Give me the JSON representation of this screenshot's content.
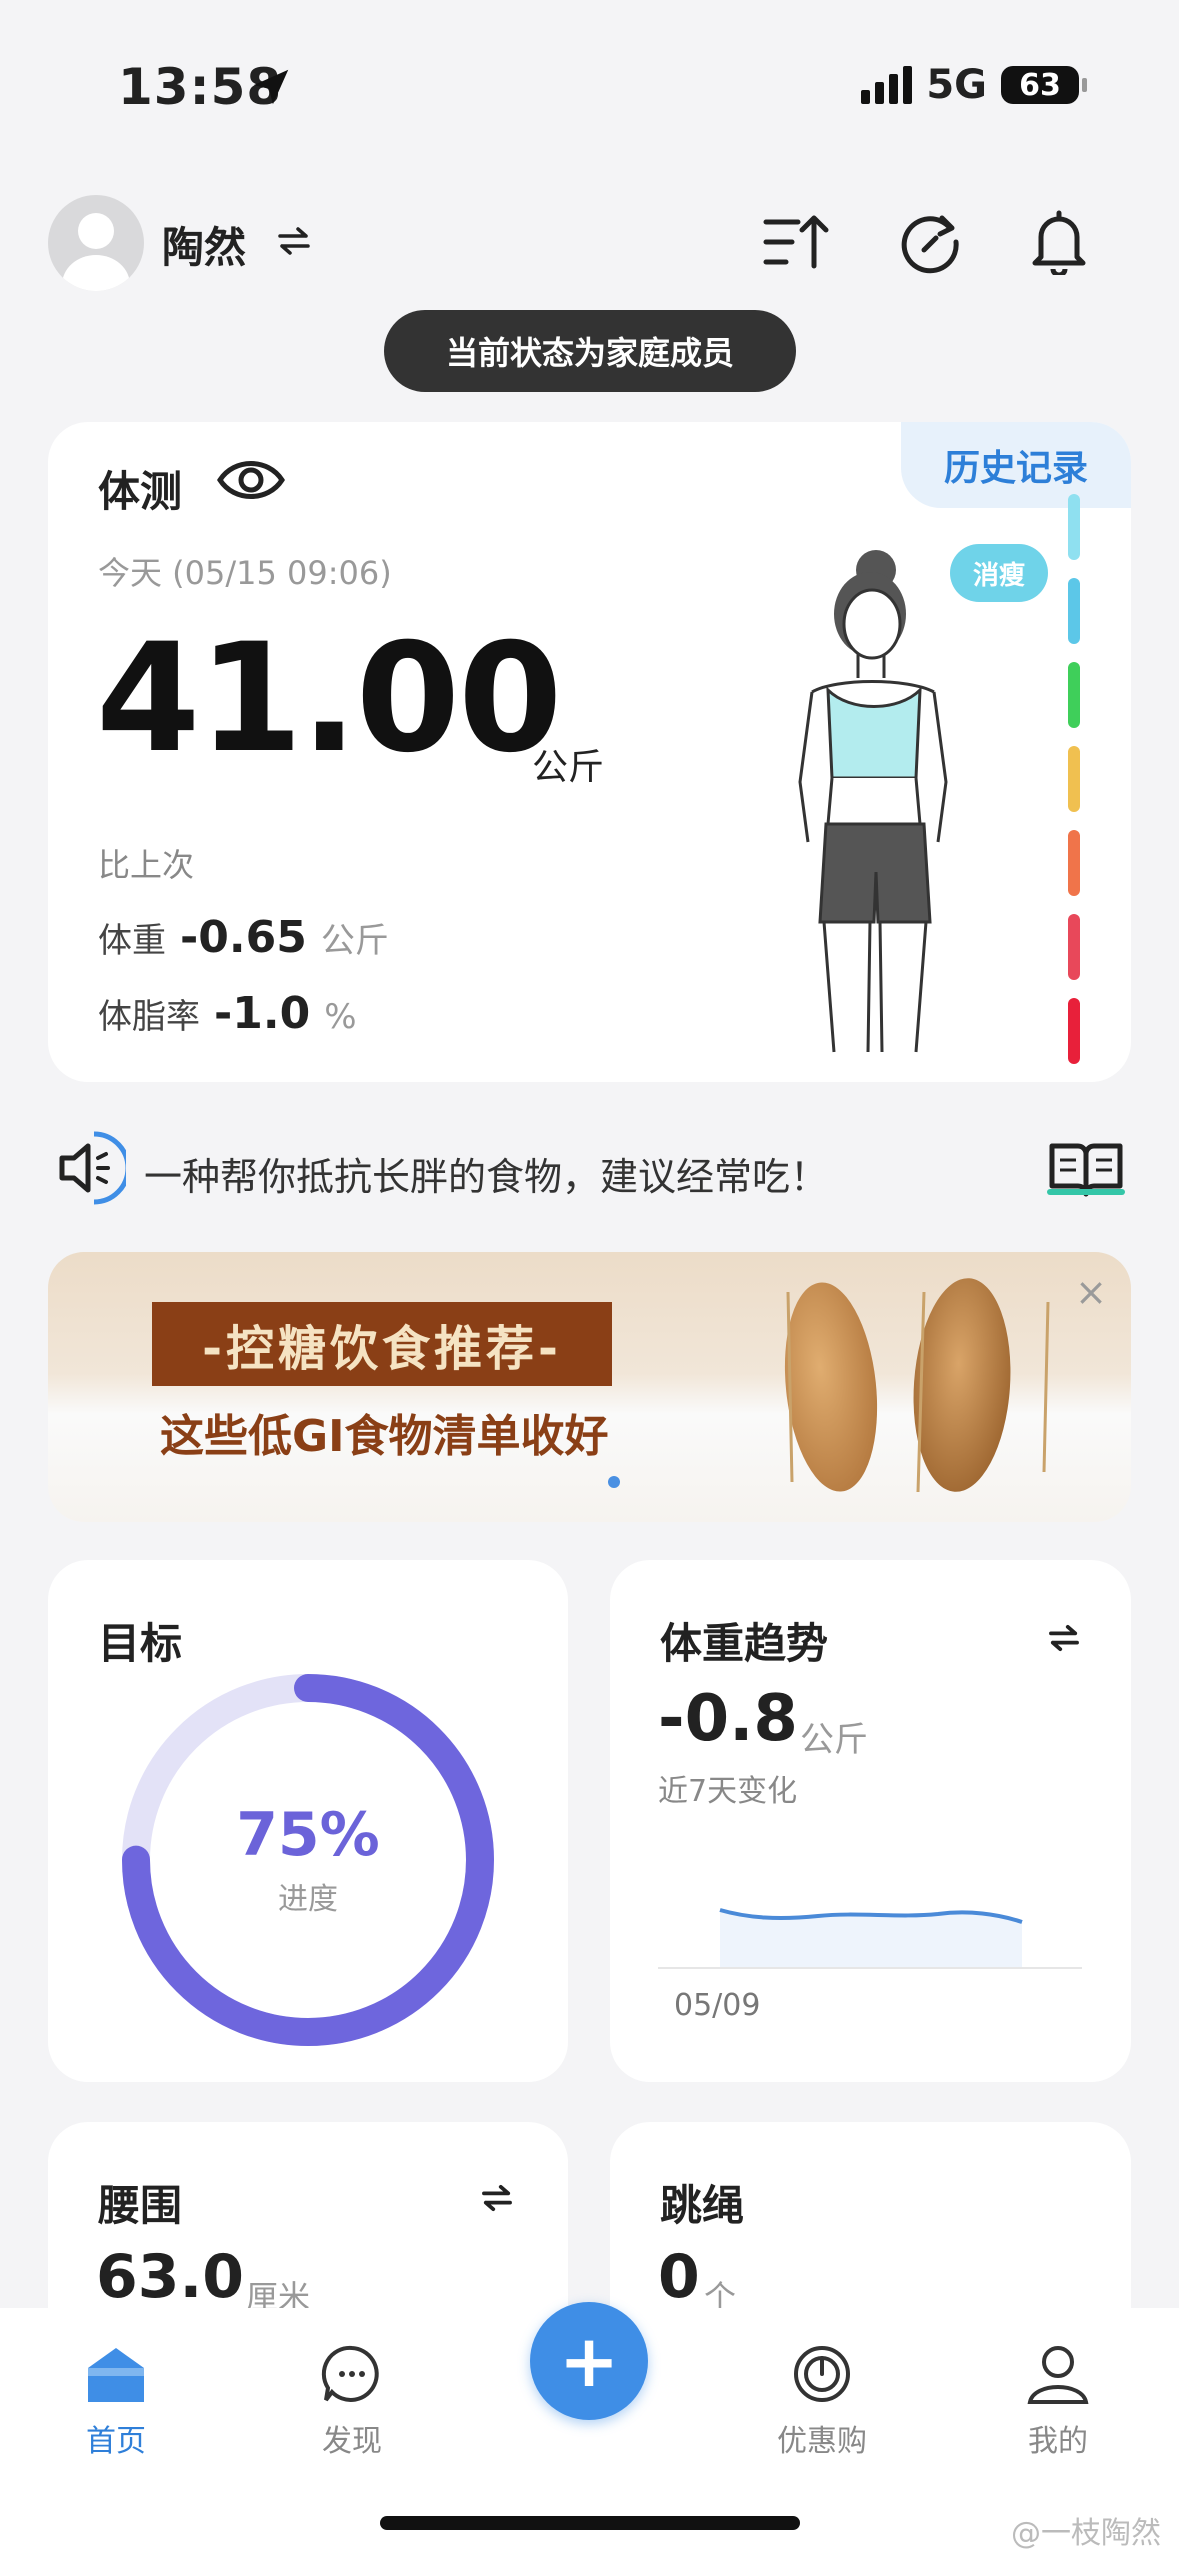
{
  "status": {
    "time": "13:58",
    "network": "5G",
    "battery": "63"
  },
  "header": {
    "user_name": "陶然",
    "family_status": "当前状态为家庭成员"
  },
  "main": {
    "title": "体测",
    "history_label": "历史记录",
    "date": "今天 (05/15 09:06)",
    "weight": "41.00",
    "weight_unit": "公斤",
    "compare_label": "比上次",
    "weight_label": "体重",
    "weight_change": "-0.65",
    "fat_label": "体脂率",
    "fat_change": "-1.0",
    "fat_unit": "%",
    "body_tag": "消瘦",
    "scale_colors": [
      "#8fe0f0",
      "#5cc7e8",
      "#3fcf5a",
      "#f0c050",
      "#f0744a",
      "#e8485a",
      "#e8203a"
    ]
  },
  "tip": {
    "text": "一种帮你抵抗长胖的食物，建议经常吃！"
  },
  "banner": {
    "tag": "-控糖饮食推荐-",
    "subtitle": "这些低GI食物清单收好",
    "close": "×"
  },
  "goal": {
    "title": "目标",
    "percent_text": "75%",
    "percent": 0.75,
    "label": "进度"
  },
  "trend": {
    "title": "体重趋势",
    "value": "-0.8",
    "unit": "公斤",
    "subtitle": "近7天变化",
    "start_date": "05/09"
  },
  "waist": {
    "title": "腰围",
    "value": "63.0",
    "unit": "厘米"
  },
  "rope": {
    "title": "跳绳",
    "value": "0",
    "unit": "个"
  },
  "tabs": [
    {
      "label": "首页"
    },
    {
      "label": "发现"
    },
    {
      "label": "优惠购"
    },
    {
      "label": "我的"
    }
  ],
  "plus": "+",
  "watermark": "@一枝陶然"
}
